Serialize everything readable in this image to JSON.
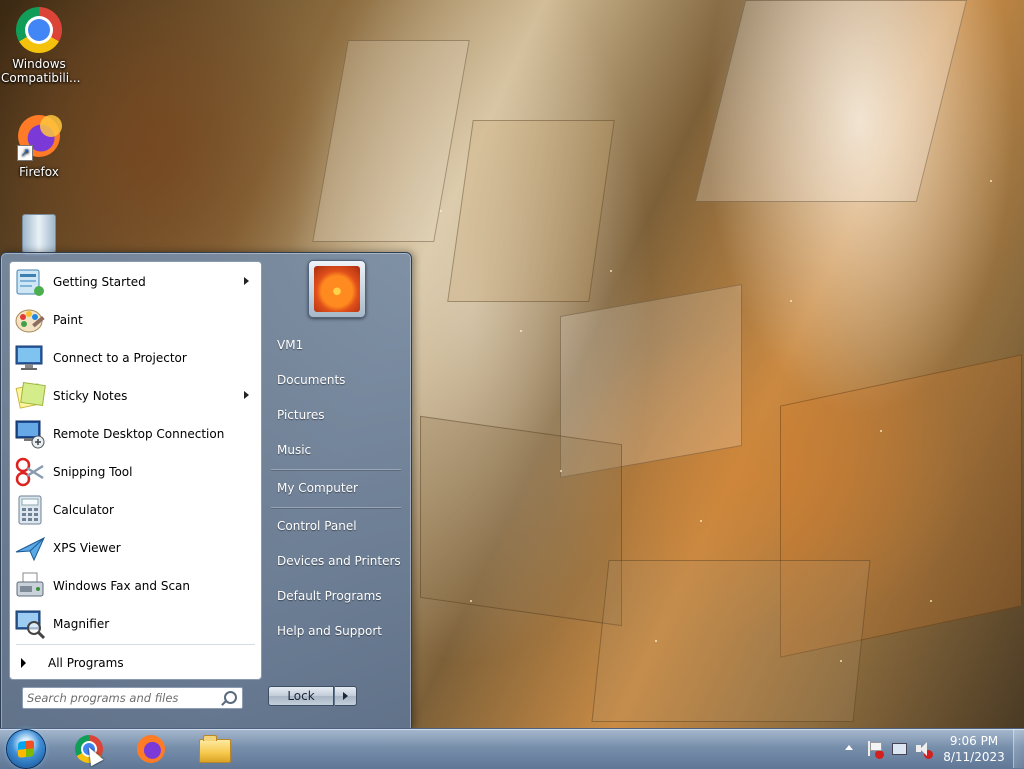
{
  "desktop": {
    "icons": [
      {
        "label": "Windows Compatibili...",
        "icon": "chrome-icon"
      },
      {
        "label": "Firefox",
        "icon": "firefox-icon"
      },
      {
        "label": "",
        "icon": "recycle-bin-icon"
      }
    ]
  },
  "start_menu": {
    "programs": [
      {
        "label": "Getting Started",
        "icon": "getting-started-icon",
        "has_submenu": true
      },
      {
        "label": "Paint",
        "icon": "paint-icon",
        "has_submenu": false
      },
      {
        "label": "Connect to a Projector",
        "icon": "projector-icon",
        "has_submenu": false
      },
      {
        "label": "Sticky Notes",
        "icon": "sticky-notes-icon",
        "has_submenu": true
      },
      {
        "label": "Remote Desktop Connection",
        "icon": "remote-desktop-icon",
        "has_submenu": false
      },
      {
        "label": "Snipping Tool",
        "icon": "snipping-tool-icon",
        "has_submenu": false
      },
      {
        "label": "Calculator",
        "icon": "calculator-icon",
        "has_submenu": false
      },
      {
        "label": "XPS Viewer",
        "icon": "xps-viewer-icon",
        "has_submenu": false
      },
      {
        "label": "Windows Fax and Scan",
        "icon": "fax-scan-icon",
        "has_submenu": false
      },
      {
        "label": "Magnifier",
        "icon": "magnifier-icon",
        "has_submenu": false
      }
    ],
    "all_programs_label": "All Programs",
    "search_placeholder": "Search programs and files",
    "right_items": [
      {
        "label": "VM1"
      },
      {
        "label": "Documents"
      },
      {
        "label": "Pictures"
      },
      {
        "label": "Music"
      },
      {
        "label": "My Computer"
      },
      {
        "label": "Control Panel"
      },
      {
        "label": "Devices and Printers"
      },
      {
        "label": "Default Programs"
      },
      {
        "label": "Help and Support"
      }
    ],
    "lock_label": "Lock"
  },
  "taskbar": {
    "pinned": [
      "chrome-icon",
      "firefox-icon",
      "file-explorer-icon"
    ],
    "clock_time": "9:06 PM",
    "clock_date": "8/11/2023"
  }
}
